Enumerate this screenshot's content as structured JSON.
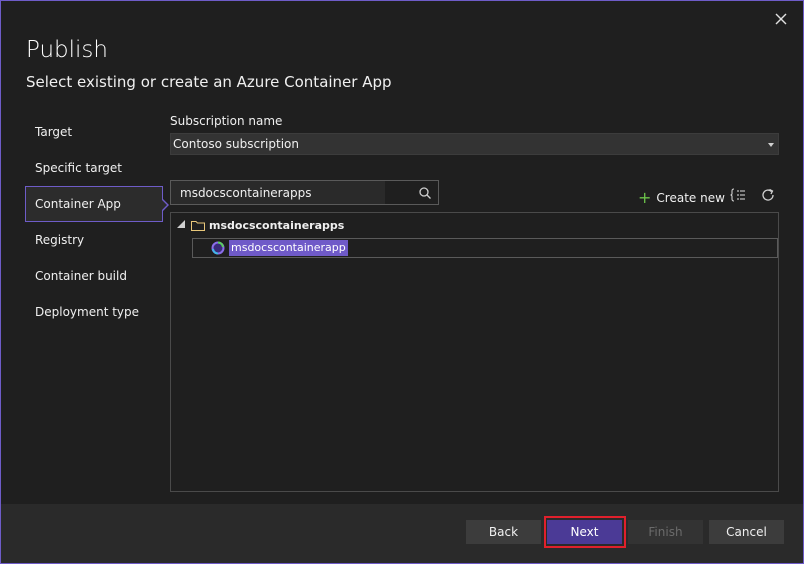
{
  "dialog": {
    "title": "Publish",
    "subtitle": "Select existing or create an Azure Container App"
  },
  "nav": {
    "items": [
      {
        "label": "Target"
      },
      {
        "label": "Specific target"
      },
      {
        "label": "Container App",
        "active": true
      },
      {
        "label": "Registry"
      },
      {
        "label": "Container build"
      },
      {
        "label": "Deployment type"
      }
    ]
  },
  "subscription": {
    "label": "Subscription name",
    "value": "Contoso subscription"
  },
  "search": {
    "value": "msdocscontainerapps"
  },
  "toolbar": {
    "create_new_label": "Create new",
    "icons": [
      "plus-icon",
      "group-by-icon",
      "refresh-icon"
    ]
  },
  "tree": {
    "group": "msdocscontainerapps",
    "items": [
      {
        "label": "msdocscontainerapp",
        "selected": true
      }
    ]
  },
  "footer": {
    "back_label": "Back",
    "next_label": "Next",
    "finish_label": "Finish",
    "cancel_label": "Cancel"
  },
  "colors": {
    "accent": "#6f5ac8",
    "primary_button": "#4b3a96",
    "highlight_box": "#e0202c",
    "background": "#1f1f1f"
  }
}
